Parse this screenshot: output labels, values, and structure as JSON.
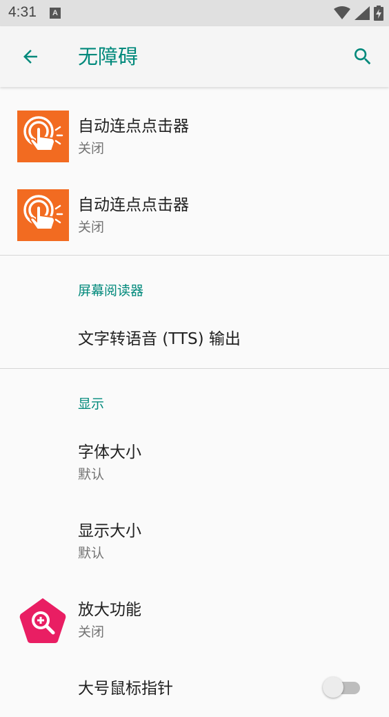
{
  "status_bar": {
    "time": "4:31",
    "notification_icon": "A",
    "icons": [
      "wifi-icon",
      "signal-icon",
      "battery-charging-icon"
    ]
  },
  "app_bar": {
    "title": "无障碍",
    "back_icon": "arrow-left-icon",
    "search_icon": "search-icon",
    "accent_color": "#00897b"
  },
  "services": [
    {
      "title": "自动连点点击器",
      "status": "关闭",
      "icon": "tap-hand-icon"
    },
    {
      "title": "自动连点点击器",
      "status": "关闭",
      "icon": "tap-hand-icon"
    }
  ],
  "screen_reader": {
    "header": "屏幕阅读器",
    "tts": "文字转语音 (TTS) 输出"
  },
  "display": {
    "header": "显示",
    "font_size": {
      "title": "字体大小",
      "value": "默认"
    },
    "display_size": {
      "title": "显示大小",
      "value": "默认"
    },
    "magnification": {
      "title": "放大功能",
      "status": "关闭",
      "icon": "magnify-pentagon-icon"
    },
    "large_pointer": {
      "title": "大号鼠标指针",
      "enabled": false
    }
  }
}
